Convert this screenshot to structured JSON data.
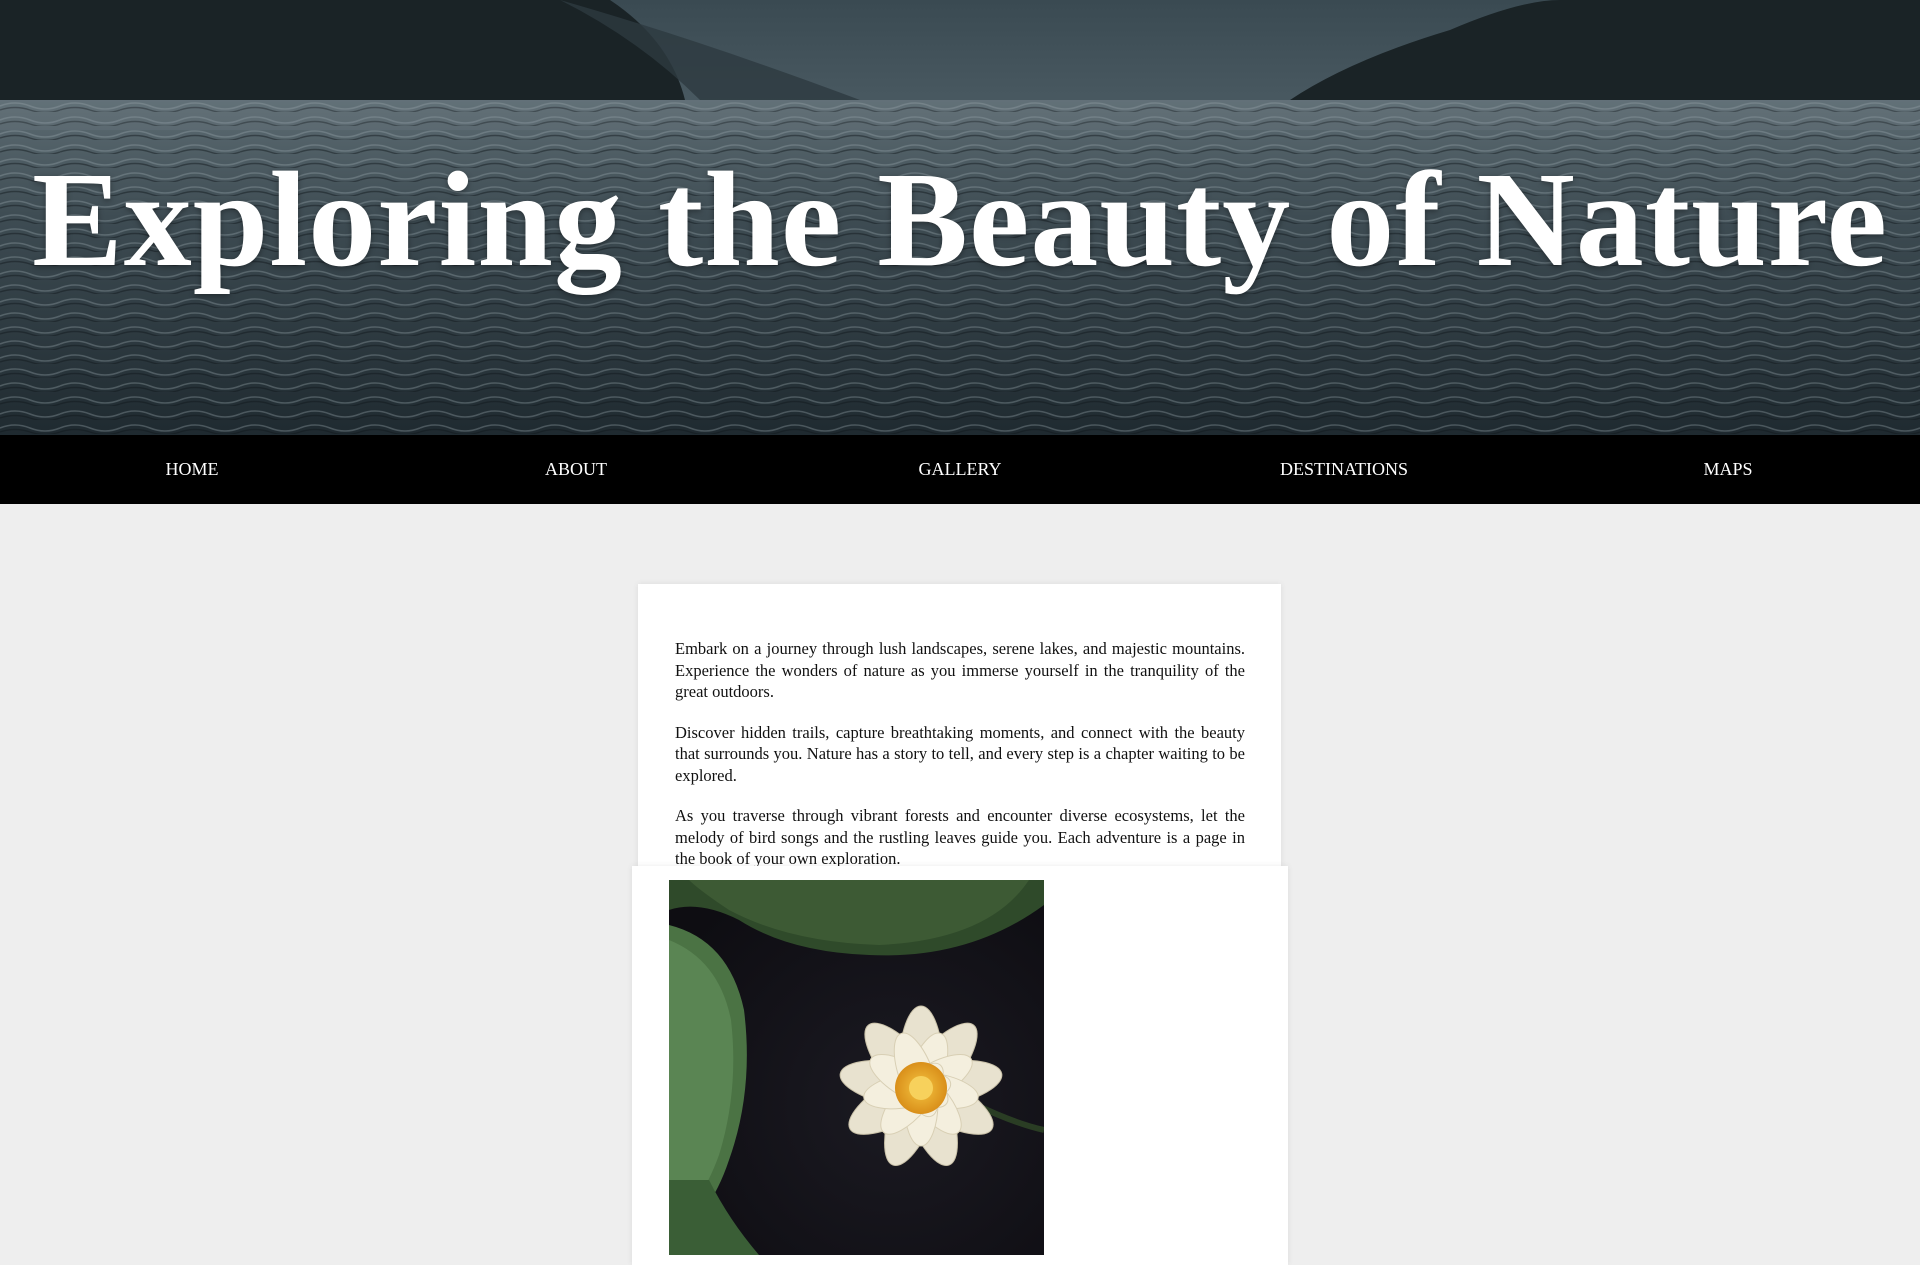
{
  "hero": {
    "title": "Exploring the Beauty of Nature",
    "image": "mountain-lake-photo"
  },
  "nav": {
    "items": [
      {
        "label": "HOME"
      },
      {
        "label": "ABOUT"
      },
      {
        "label": "GALLERY"
      },
      {
        "label": "DESTINATIONS"
      },
      {
        "label": "MAPS"
      }
    ]
  },
  "content": {
    "paragraphs": [
      "Embark on a journey through lush landscapes, serene lakes, and majestic mountains. Experience the wonders of nature as you immerse yourself in the tranquility of the great outdoors.",
      "Discover hidden trails, capture breathtaking moments, and connect with the beauty that surrounds you. Nature has a story to tell, and every step is a chapter waiting to be explored.",
      "As you traverse through vibrant forests and encounter diverse ecosystems, let the melody of bird songs and the rustling leaves guide you. Each adventure is a page in the book of your own exploration."
    ]
  },
  "gallery": {
    "image": "water-lily-photo"
  },
  "colors": {
    "page_background": "#eeeeee",
    "nav_background": "#000000",
    "card_background": "#ffffff",
    "text": "#111111",
    "hero_text": "#ffffff"
  }
}
